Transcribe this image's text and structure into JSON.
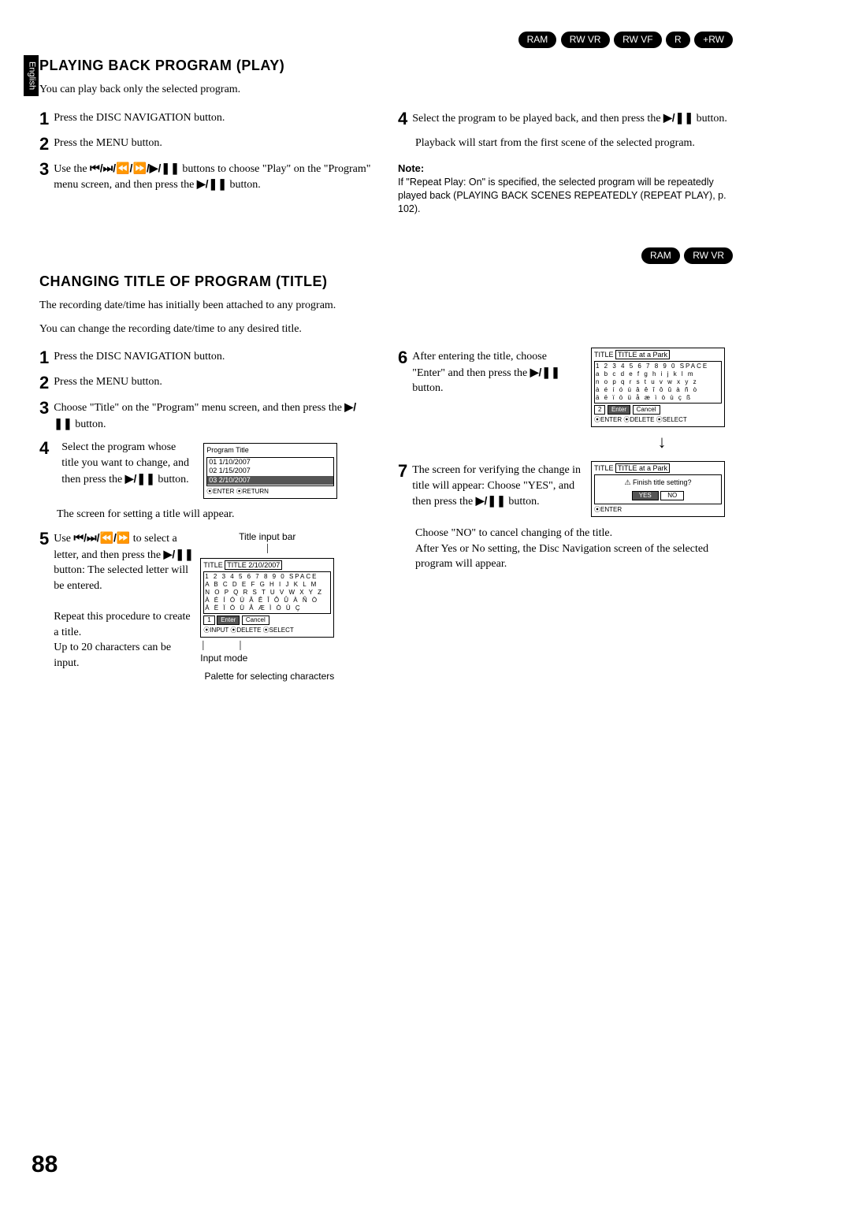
{
  "sideTab": "English",
  "badges1": [
    "RAM",
    "RW VR",
    "RW VF",
    "R",
    "+RW"
  ],
  "badges2": [
    "RAM",
    "RW VR"
  ],
  "section1": {
    "title": "PLAYING BACK PROGRAM (PLAY)",
    "intro": "You can play back only the selected program.",
    "steps_left": {
      "s1": "Press the DISC NAVIGATION button.",
      "s2": "Press the MENU button.",
      "s3a": "Use the ",
      "s3icons": "⏮/⏭/⏪/⏩/▶/❚❚",
      "s3b": " buttons to choose \"Play\" on the \"Program\" menu screen, and then press the ",
      "s3c": " button."
    },
    "steps_right": {
      "s4a": "Select the program to be played back, and then press the ",
      "s4b": " button.",
      "s4c": "Playback will start from the first scene of the selected program."
    },
    "noteLabel": "Note:",
    "noteText": "If \"Repeat Play: On\" is specified, the selected program will be repeatedly played back (PLAYING BACK SCENES REPEATEDLY (REPEAT PLAY), p. 102)."
  },
  "section2": {
    "title": "CHANGING TITLE OF PROGRAM (TITLE)",
    "intro1": "The recording date/time has initially been attached to any program.",
    "intro2": "You can change the recording date/time to any desired title.",
    "left": {
      "s1": "Press the DISC NAVIGATION button.",
      "s2": "Press the MENU button.",
      "s3a": "Choose \"Title\" on the \"Program\" menu screen, and then press the ",
      "s3b": " button.",
      "s4a": "Select the program whose title you want to change, and then press the ",
      "s4b": " button.",
      "s4after": "The screen for setting a title will appear.",
      "s5a": "Use ",
      "s5icons": "⏮/⏭/⏪/⏩",
      "s5b": " to select a letter, and then press the ",
      "s5c": " button: The selected letter will be entered.",
      "s5d": "Repeat this procedure to create a title.",
      "s5e": "Up to 20 characters can be input."
    },
    "programTitleScreen": {
      "header": "Program Title",
      "rows": [
        "01   1/10/2007",
        "02   1/15/2007",
        "03   2/10/2007"
      ],
      "footer": "⦿ENTER ⦿RETURN"
    },
    "titleInputLabel": "Title input bar",
    "inputModeLabel": "Input mode",
    "paletteLabel": "Palette for selecting characters",
    "titleScreen1": {
      "header": "TITLE  2/10/2007",
      "row1": "1 2 3 4 5 6 7 8 9 0 SPACE",
      "row2": "A B C D E F G H I J K L M",
      "row3": "N O P Q R S T U V W X Y Z",
      "row4": "À É Í Ó Ú Â Ê Î Ô Û À Ñ Ò",
      "row5": "Ä Ë Ï Ö Ü Å Æ Ì Ò Ù Ç",
      "footer1_mode": "1",
      "footer1_enter": "Enter",
      "footer1_cancel": "Cancel",
      "footer2": "⦿INPUT ⦿DELETE ⦿SELECT"
    },
    "right": {
      "s6a": "After entering the title, choose \"Enter\" and then press the ",
      "s6b": " button.",
      "s7a": "The screen for verifying the change in title will appear: Choose \"YES\", and then press the ",
      "s7b": " button.",
      "after1": "Choose \"NO\" to cancel changing of the title.",
      "after2": "After Yes or No setting, the Disc Navigation screen of the selected program will appear."
    },
    "titleScreen2": {
      "header": "TITLE  at a Park",
      "row1": "1 2 3 4 5 6 7 8 9 0 SPACE",
      "row2": "a b c d e f g h i j k l m",
      "row3": "n o p q r s t u v w x y z",
      "row4": "à é í ó ú â ê î ô û à ñ ò",
      "row5": "ä ë ï ö ü å æ ì ò ù ç ß",
      "footer1_mode": "2",
      "footer1_enter": "Enter",
      "footer1_cancel": "Cancel",
      "footer2": "⦿ENTER ⦿DELETE ⦿SELECT"
    },
    "confirmScreen": {
      "header": "TITLE  at a Park",
      "prompt": "⚠ Finish title setting?",
      "yes": "YES",
      "no": "NO",
      "footer": "⦿ENTER"
    }
  },
  "playIcon": "▶/❚❚",
  "pageNumber": "88"
}
